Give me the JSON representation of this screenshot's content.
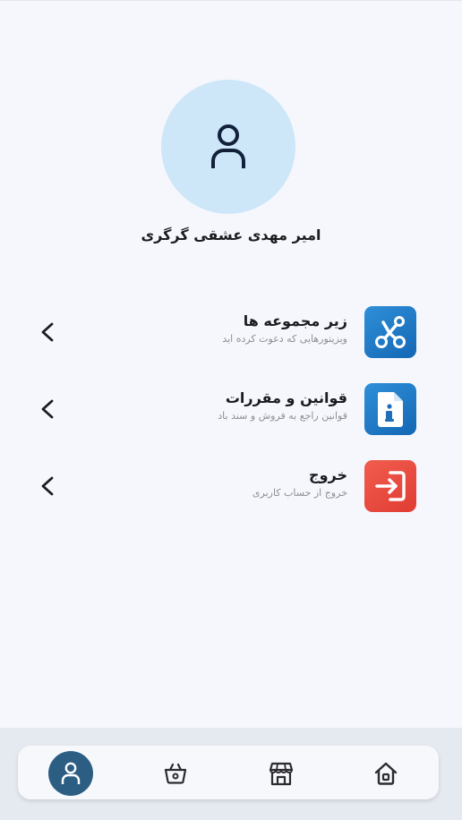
{
  "profile": {
    "name": "امیر مهدی عشقی گرگری",
    "avatar_icon": "user-icon"
  },
  "menu": [
    {
      "title": "زیر مجموعه ها",
      "subtitle": "ویزیتورهایی که دعوت کرده اید",
      "icon": "share-nodes-icon",
      "color": "#1e7ac6"
    },
    {
      "title": "قوانین و مقررات",
      "subtitle": "قوانین راجع به فروش و سند باد",
      "icon": "info-document-icon",
      "color": "#1e7ac6"
    },
    {
      "title": "خروج",
      "subtitle": "خروج از حساب کاربری",
      "icon": "logout-icon",
      "color": "#e8473d"
    }
  ],
  "bottom_nav": {
    "active": "profile",
    "items": [
      "profile-icon",
      "basket-icon",
      "store-icon",
      "home-icon"
    ],
    "active_color": "#2c5e84"
  }
}
